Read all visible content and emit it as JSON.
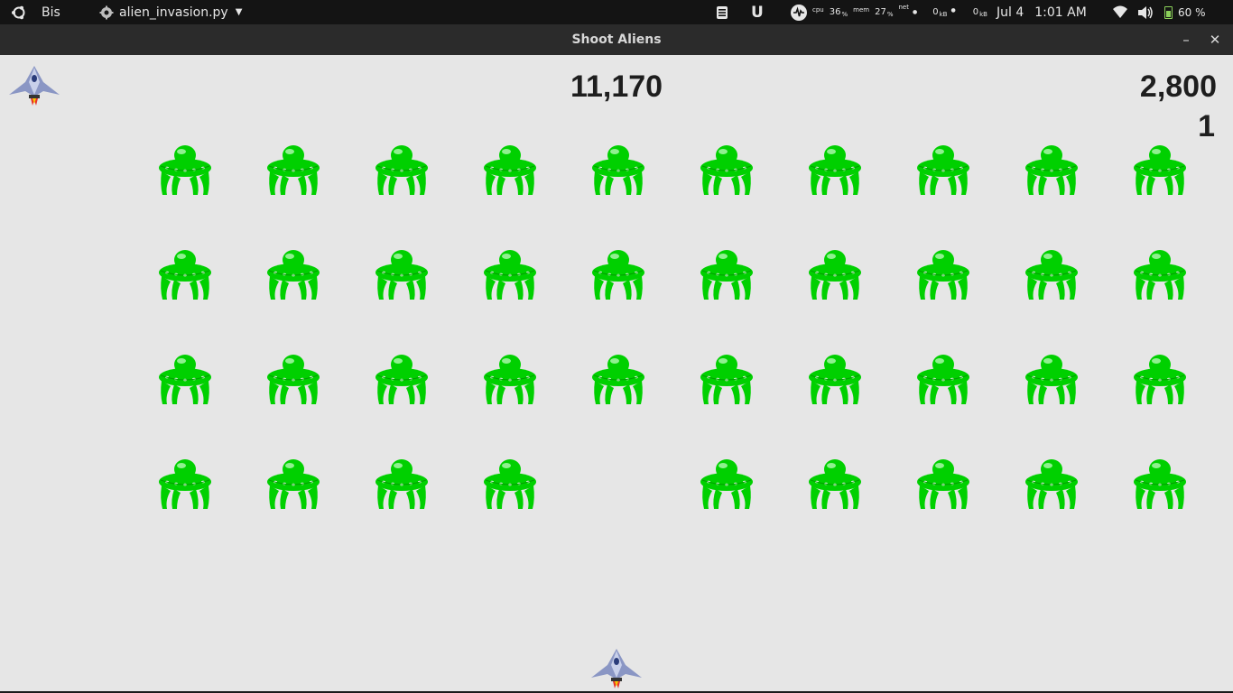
{
  "panel": {
    "activities_icon": "ubuntu-logo-icon",
    "workspace_label": "Bis",
    "app_label": "alien_invasion.py",
    "sysmon": {
      "cpu_label": "cpu",
      "cpu_value": "36",
      "mem_label": "mem",
      "mem_value": "27",
      "net_label": "net",
      "pct": "%",
      "down_value": "0",
      "up_value": "0",
      "unit": "kB"
    },
    "date": "Jul 4",
    "time": "1:01 AM",
    "battery": "60 %"
  },
  "window": {
    "title": "Shoot Aliens",
    "minimize_glyph": "–",
    "close_glyph": "✕"
  },
  "game": {
    "score": "11,170",
    "high_score": "2,800",
    "level": "1",
    "ships_left": 1,
    "colors": {
      "background": "#e6e6e6",
      "alien": "#00d000",
      "text": "#1e1e1e"
    },
    "alien_fleet": {
      "rows": 4,
      "columns": 10,
      "missing": [
        [
          3,
          4
        ]
      ]
    }
  }
}
